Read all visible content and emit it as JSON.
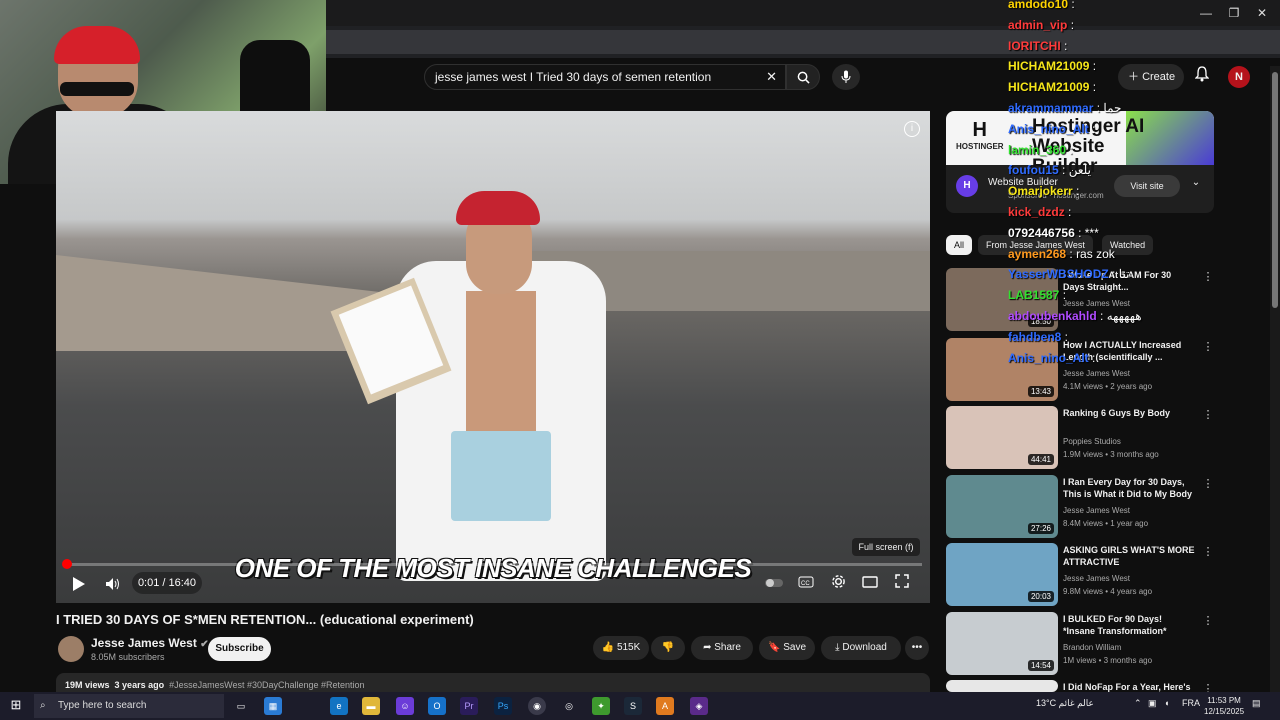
{
  "browser": {
    "window_controls": [
      "—",
      "❐",
      "✕"
    ]
  },
  "header": {
    "search_value": "jesse james west I Tried 30 days of semen retention",
    "clear_glyph": "✕",
    "create_label": "Create",
    "avatar_letter": "N"
  },
  "video": {
    "caption": "ONE OF THE MOST INSANE CHALLENGES",
    "time": "0:01 / 16:40",
    "progress_fraction": 0.001,
    "fullscreen_tooltip": "Full screen (f)",
    "title": "I TRIED 30 DAYS OF S*MEN RETENTION... (educational experiment)",
    "channel": "Jesse James West",
    "subscribers": "8.05M subscribers",
    "subscribe_label": "Subscribe",
    "likes": "515K",
    "share_label": "Share",
    "save_label": "Save",
    "download_label": "Download",
    "views": "19M views",
    "age": "3 years ago",
    "tags": "#JesseJamesWest #30DayChallenge #Retention"
  },
  "ad": {
    "brand": "HOSTINGER",
    "headline": "Hostinger AI Website Builder",
    "title": "Website Builder",
    "sponsored": "Sponsored · hostinger.com",
    "visit_label": "Visit site"
  },
  "chips": [
    "All",
    "From Jesse James West",
    "Watched"
  ],
  "recommendations": [
    {
      "title": "I Woke Up At 5 AM For 30 Days Straight...",
      "channel": "Jesse James West",
      "meta": "",
      "duration": "18:50",
      "thumb": "#7c6a5c"
    },
    {
      "title": "How I ACTUALLY Increased Length (scientifically ...",
      "channel": "Jesse James West",
      "meta": "4.1M views • 2 years ago",
      "duration": "13:43",
      "thumb": "#b08366"
    },
    {
      "title": "Ranking 6 Guys By Body",
      "channel": "Poppies Studios",
      "meta": "1.9M views • 3 months ago",
      "duration": "44:41",
      "thumb": "#d9c3b8"
    },
    {
      "title": "I Ran Every Day for 30 Days, This is What it Did to My Body",
      "channel": "Jesse James West",
      "meta": "8.4M views • 1 year ago",
      "duration": "27:26",
      "thumb": "#5f8a8f"
    },
    {
      "title": "ASKING GIRLS WHAT'S MORE ATTRACTIVE",
      "channel": "Jesse James West",
      "meta": "9.8M views • 4 years ago",
      "duration": "20:03",
      "thumb": "#6fa4c4"
    },
    {
      "title": "I BULKED For 90 Days! *Insane Transformation*",
      "channel": "Brandon William",
      "meta": "1M views • 3 months ago",
      "duration": "14:54",
      "thumb": "#c7ccd0"
    },
    {
      "title": "I Did NoFap For a Year, Here's",
      "channel": "",
      "meta": "",
      "duration": "",
      "thumb": "#e7e7e7"
    }
  ],
  "chat": [
    {
      "user": "amdodo10",
      "msg": "",
      "color": "#ffd400"
    },
    {
      "user": "admin_vip",
      "msg": "",
      "color": "#ff3b3b"
    },
    {
      "user": "IORITCHI",
      "msg": "",
      "color": "#ff3b3b"
    },
    {
      "user": "HICHAM21009",
      "msg": "",
      "color": "#f6e61a"
    },
    {
      "user": "HICHAM21009",
      "msg": "",
      "color": "#f6e61a"
    },
    {
      "user": "akrammammar",
      "msg": "حما",
      "color": "#2f6bff"
    },
    {
      "user": "Anis_nino_Alt",
      "msg": "",
      "color": "#2f6bff"
    },
    {
      "user": "lamin_360",
      "msg": "",
      "color": "#32e02f"
    },
    {
      "user": "foufou15",
      "msg": "يلعن",
      "color": "#2f6bff"
    },
    {
      "user": "Omarjokerr",
      "msg": "",
      "color": "#f6e61a"
    },
    {
      "user": "kick_dzdz",
      "msg": "",
      "color": "#ff3b3b"
    },
    {
      "user": "0792446756",
      "msg": "***",
      "color": "#ffffff"
    },
    {
      "user": "aymen268",
      "msg": "ras zok",
      "color": "#ff9a1f"
    },
    {
      "user": "YasserWBSHODZ",
      "msg": "تنا",
      "color": "#2f6bff"
    },
    {
      "user": "LAB1587",
      "msg": "",
      "color": "#32e02f"
    },
    {
      "user": "abdoubenkahld",
      "msg": "هههههه",
      "color": "#b04bff"
    },
    {
      "user": "fahdben8",
      "msg": "",
      "color": "#2f6bff"
    },
    {
      "user": "Anis_nino_Alt",
      "msg": "",
      "color": "#2f6bff"
    }
  ],
  "taskbar": {
    "search_placeholder": "Type here to search",
    "weather": "13°C  عالم غائم",
    "lang": "FRA",
    "time": "11:53 PM",
    "date": "12/15/2025"
  }
}
